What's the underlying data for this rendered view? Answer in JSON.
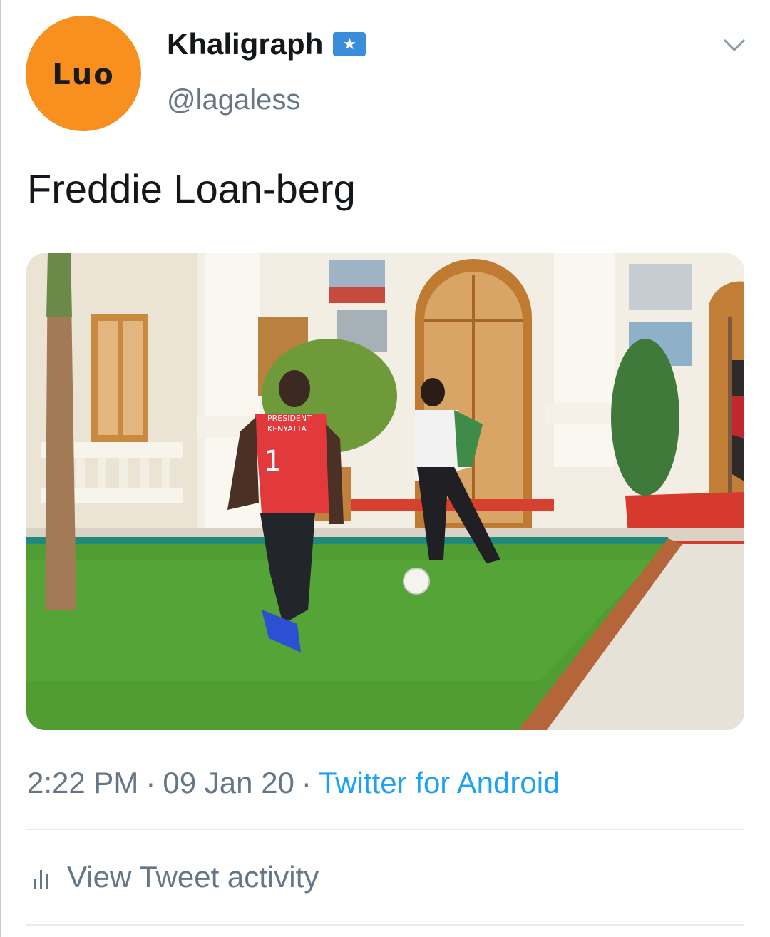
{
  "tweet": {
    "avatar_text": "Luo",
    "display_name": "Khaligraph",
    "handle": "@lagaless",
    "text": "Freddie Loan-berg",
    "time": "2:22 PM",
    "date": "09 Jan 20",
    "source": "Twitter for Android",
    "separator": "·",
    "activity_label": "View Tweet activity"
  },
  "photo": {
    "jersey_text_line1": "PRESIDENT",
    "jersey_text_line2": "KENYATTA",
    "jersey_number": "1"
  },
  "colors": {
    "avatar_bg": "#f7901e",
    "verified": "#3a8ddb",
    "link": "#1da1f2",
    "muted": "#657786"
  },
  "icons": {
    "verified": "verified-badge-icon",
    "more": "chevron-down-icon",
    "activity": "bar-chart-icon"
  }
}
